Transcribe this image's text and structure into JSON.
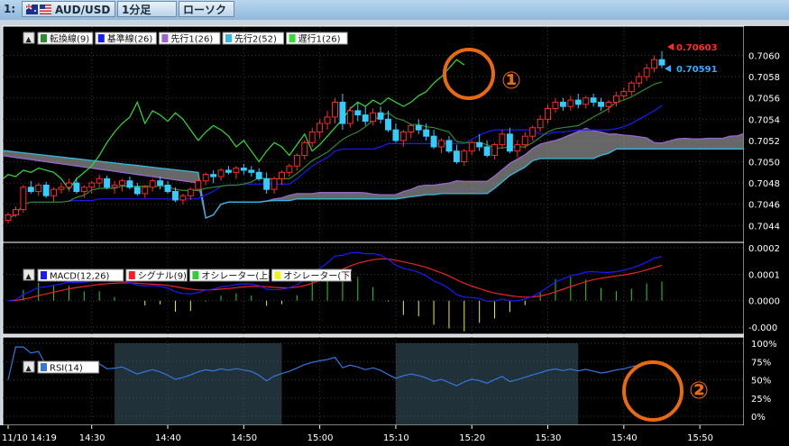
{
  "toolbar": {
    "index_label": "1:",
    "symbol": "AUD/USD",
    "timeframe": "1分足",
    "chart_type": "ローソク"
  },
  "chart_data": [
    {
      "type": "candlestick",
      "panel": "price",
      "y_ticks": [
        "0.7060",
        "0.7058",
        "0.7056",
        "0.7054",
        "0.7052",
        "0.7050",
        "0.7048",
        "0.7046",
        "0.7044"
      ],
      "ylim": [
        0.70425,
        0.70625
      ],
      "legend": [
        "転換線(9)",
        "基準線(26)",
        "先行1(26)",
        "先行2(52)",
        "遅行1(26)"
      ],
      "series_colors": {
        "転換線": "#2e8b2e",
        "基準線": "#1a1aff",
        "先行1": "#9966cc",
        "先行2": "#33bbdd",
        "遅行1": "#33dd33"
      },
      "price_labels": {
        "ask": "0.70603",
        "bid": "0.70591"
      },
      "annotation": "①",
      "candles": [
        [
          0.70445,
          0.70452,
          0.70442,
          0.7045
        ],
        [
          0.7045,
          0.70458,
          0.70448,
          0.70455
        ],
        [
          0.70455,
          0.70478,
          0.70452,
          0.70476
        ],
        [
          0.70476,
          0.70482,
          0.7047,
          0.70472
        ],
        [
          0.70472,
          0.7048,
          0.70468,
          0.70478
        ],
        [
          0.70478,
          0.70481,
          0.70466,
          0.70468
        ],
        [
          0.70468,
          0.70476,
          0.70462,
          0.70474
        ],
        [
          0.70474,
          0.7048,
          0.7047,
          0.70476
        ],
        [
          0.70476,
          0.70484,
          0.70472,
          0.7048
        ],
        [
          0.7048,
          0.70485,
          0.7047,
          0.70472
        ],
        [
          0.70472,
          0.70478,
          0.70466,
          0.70476
        ],
        [
          0.70476,
          0.70482,
          0.7047,
          0.7048
        ],
        [
          0.7048,
          0.70488,
          0.70476,
          0.70484
        ],
        [
          0.70484,
          0.70487,
          0.70474,
          0.70476
        ],
        [
          0.70476,
          0.70482,
          0.7047,
          0.70478
        ],
        [
          0.70478,
          0.70484,
          0.70472,
          0.70482
        ],
        [
          0.70482,
          0.70486,
          0.70474,
          0.70476
        ],
        [
          0.70476,
          0.7048,
          0.70468,
          0.7047
        ],
        [
          0.7047,
          0.70478,
          0.70466,
          0.70476
        ],
        [
          0.70476,
          0.70484,
          0.70472,
          0.70482
        ],
        [
          0.70482,
          0.70486,
          0.70474,
          0.70478
        ],
        [
          0.70478,
          0.70482,
          0.7047,
          0.70472
        ],
        [
          0.70472,
          0.70476,
          0.70462,
          0.70464
        ],
        [
          0.70464,
          0.7047,
          0.7046,
          0.70468
        ],
        [
          0.70468,
          0.70476,
          0.70464,
          0.70474
        ],
        [
          0.70474,
          0.70484,
          0.70472,
          0.70482
        ],
        [
          0.70482,
          0.7049,
          0.70478,
          0.70488
        ],
        [
          0.70488,
          0.70492,
          0.7048,
          0.70486
        ],
        [
          0.70486,
          0.70494,
          0.70482,
          0.70492
        ],
        [
          0.70492,
          0.70496,
          0.70488,
          0.7049
        ],
        [
          0.7049,
          0.70496,
          0.70484,
          0.70494
        ],
        [
          0.70494,
          0.70498,
          0.70488,
          0.70492
        ],
        [
          0.70492,
          0.70496,
          0.70486,
          0.7049
        ],
        [
          0.7049,
          0.70494,
          0.70482,
          0.70484
        ],
        [
          0.70484,
          0.7049,
          0.7047,
          0.70474
        ],
        [
          0.70474,
          0.70486,
          0.7047,
          0.70484
        ],
        [
          0.70484,
          0.70492,
          0.70478,
          0.7049
        ],
        [
          0.7049,
          0.70498,
          0.70486,
          0.70496
        ],
        [
          0.70496,
          0.70508,
          0.70492,
          0.70506
        ],
        [
          0.70506,
          0.7052,
          0.70502,
          0.70518
        ],
        [
          0.70518,
          0.70532,
          0.70514,
          0.70528
        ],
        [
          0.70528,
          0.7054,
          0.70522,
          0.70536
        ],
        [
          0.70536,
          0.70548,
          0.7053,
          0.70542
        ],
        [
          0.70542,
          0.7056,
          0.70536,
          0.70556
        ],
        [
          0.70556,
          0.70564,
          0.7053,
          0.70536
        ],
        [
          0.70536,
          0.70552,
          0.70532,
          0.70548
        ],
        [
          0.70548,
          0.70556,
          0.70538,
          0.70544
        ],
        [
          0.70544,
          0.70552,
          0.70534,
          0.70538
        ],
        [
          0.70538,
          0.7055,
          0.70534,
          0.70546
        ],
        [
          0.70546,
          0.70552,
          0.70536,
          0.7054
        ],
        [
          0.7054,
          0.70548,
          0.70528,
          0.7053
        ],
        [
          0.7053,
          0.70536,
          0.70518,
          0.7052
        ],
        [
          0.7052,
          0.7053,
          0.70514,
          0.70528
        ],
        [
          0.70528,
          0.70536,
          0.70522,
          0.70534
        ],
        [
          0.70534,
          0.7054,
          0.70526,
          0.7053
        ],
        [
          0.7053,
          0.70536,
          0.7052,
          0.70524
        ],
        [
          0.70524,
          0.7053,
          0.70512,
          0.70514
        ],
        [
          0.70514,
          0.70522,
          0.70508,
          0.7052
        ],
        [
          0.7052,
          0.70524,
          0.70508,
          0.7051
        ],
        [
          0.7051,
          0.70516,
          0.70498,
          0.705
        ],
        [
          0.705,
          0.70512,
          0.70496,
          0.7051
        ],
        [
          0.7051,
          0.7052,
          0.70506,
          0.70518
        ],
        [
          0.70518,
          0.70526,
          0.7051,
          0.70514
        ],
        [
          0.70514,
          0.7052,
          0.70504,
          0.70506
        ],
        [
          0.70506,
          0.70518,
          0.70502,
          0.70516
        ],
        [
          0.70516,
          0.7053,
          0.70512,
          0.70526
        ],
        [
          0.70526,
          0.70532,
          0.70508,
          0.7051
        ],
        [
          0.7051,
          0.7052,
          0.70504,
          0.70516
        ],
        [
          0.70516,
          0.70528,
          0.70512,
          0.70524
        ],
        [
          0.70524,
          0.70534,
          0.7052,
          0.70532
        ],
        [
          0.70532,
          0.70544,
          0.70528,
          0.7054
        ],
        [
          0.7054,
          0.70554,
          0.70536,
          0.7055
        ],
        [
          0.7055,
          0.7056,
          0.70546,
          0.70556
        ],
        [
          0.70556,
          0.7056,
          0.70548,
          0.70552
        ],
        [
          0.70552,
          0.70562,
          0.70548,
          0.70558
        ],
        [
          0.70558,
          0.70564,
          0.7055,
          0.70554
        ],
        [
          0.70554,
          0.70562,
          0.7055,
          0.7056
        ],
        [
          0.7056,
          0.70564,
          0.70552,
          0.70556
        ],
        [
          0.70556,
          0.7056,
          0.70548,
          0.70552
        ],
        [
          0.70552,
          0.70558,
          0.70546,
          0.70556
        ],
        [
          0.70556,
          0.70566,
          0.70552,
          0.70562
        ],
        [
          0.70562,
          0.7057,
          0.70558,
          0.70566
        ],
        [
          0.70566,
          0.70576,
          0.70562,
          0.70574
        ],
        [
          0.70574,
          0.70584,
          0.7057,
          0.7058
        ],
        [
          0.7058,
          0.70592,
          0.70576,
          0.70588
        ],
        [
          0.70588,
          0.706,
          0.70584,
          0.70596
        ],
        [
          0.70596,
          0.70604,
          0.70588,
          0.70591
        ]
      ]
    },
    {
      "type": "line",
      "panel": "macd",
      "y_ticks": [
        "0.0002",
        "0.0001",
        "0.0000",
        "-0.000"
      ],
      "ylim": [
        -0.00012,
        0.00021
      ],
      "legend": [
        "MACD(12,26)",
        "シグナル(9)",
        "オシレーター(上昇)",
        "オシレーター(下降)"
      ],
      "series_colors": {
        "MACD": "#1a1aff",
        "シグナル": "#ee2222",
        "上昇": "#33cc33",
        "下降": "#eeee33"
      }
    },
    {
      "type": "line",
      "panel": "rsi",
      "y_ticks": [
        "100%",
        "75%",
        "50%",
        "25%",
        "0%"
      ],
      "ylim": [
        0,
        100
      ],
      "legend": [
        "RSI(14)"
      ],
      "series_colors": {
        "RSI": "#3377dd"
      },
      "annotation": "②"
    }
  ],
  "x_axis": {
    "ticks": [
      "11/10 14:19",
      "14:30",
      "14:40",
      "14:50",
      "15:00",
      "15:10",
      "15:20",
      "15:30",
      "15:40",
      "15:50"
    ]
  }
}
